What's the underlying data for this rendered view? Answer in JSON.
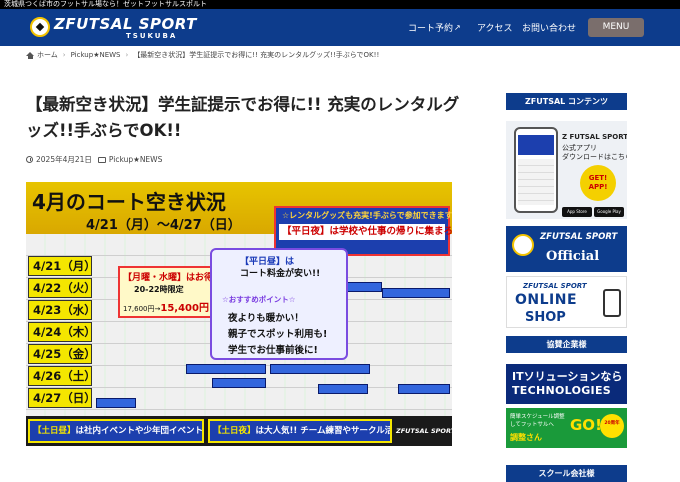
{
  "topbar": {
    "tagline": "茨城県つくば市のフットサル場なら！ゼットフットサルスポルト"
  },
  "header": {
    "logo": {
      "name": "ZFUTSAL SPORT",
      "sub": "TSUKUBA"
    },
    "nav": [
      {
        "label": "コート予約",
        "external": true
      },
      {
        "label": "アクセス",
        "external": false
      },
      {
        "label": "お問い合わせ",
        "external": false
      }
    ],
    "menu_label": "MENU"
  },
  "breadcrumb": {
    "home": "ホーム",
    "category": "Pickup★NEWS",
    "current": "【最新空き状況】学生証提示でお得に!! 充実のレンタルグッズ!!手ぶらでOK!!"
  },
  "post": {
    "title": "【最新空き状況】学生証提示でお得に!! 充実のレンタルグッズ!!手ぶらでOK!!",
    "date": "2025年4月21日",
    "category": "Pickup★NEWS"
  },
  "hero": {
    "title": "4月のコート空き状況",
    "range": "4/21（月）〜4/27（日）",
    "days": [
      "4/21（月）",
      "4/22（火）",
      "4/23（水）",
      "4/24（木）",
      "4/25（金）",
      "4/26（土）",
      "4/27（日）"
    ],
    "badge_line1": "☆レンタルグッズも充実!手ぶらで参加できます☆",
    "badge_line2": "【平日夜】は学校や仕事の帰りに集まろう!!",
    "promo1_a": "【月曜・水曜】はお得!!",
    "promo1_b": "20-22時限定",
    "promo1_c": "17,600円→",
    "promo1_price": "15,400円",
    "promo2_h": "【平日昼】は",
    "promo2_h2": "コート料金が安い!!",
    "promo2_p": "☆おすすめポイント☆",
    "promo2_q": [
      "夜よりも暖かい！",
      "親子でスポット利用も!",
      "学生でお仕事前後に!"
    ],
    "bottom_left_k": "【土日昼】",
    "bottom_left": "は社内イベントや少年団イベントに!!",
    "bottom_mid_k": "【土日夜】",
    "bottom_mid": "は大人気!! チーム練習やサークル活動にピッタリ!!",
    "bottom_logo": "ZFUTSAL SPORT"
  },
  "sidebar": {
    "contents_head": "ZFUTSAL コンテンツ",
    "app": {
      "t1": "Z FUTSAL SPORT",
      "t2": "公式アプリ",
      "t3": "ダウンロードはこちら",
      "get": "GET! APP!",
      "store1": "App Store",
      "store2": "Google Play"
    },
    "official": {
      "l1": "ZFUTSAL SPORT",
      "l2": "Official"
    },
    "shop": {
      "l1": "ZFUTSAL SPORT",
      "l2": "ONLINE",
      "l3": "SHOP"
    },
    "sponsor_head": "協賛企業様",
    "it": {
      "l1": "ITソリューションなら",
      "l2": "TECHNOLOGIES"
    },
    "green": {
      "l1": "簡単スケジュール調整",
      "l2": "してフットサルへ",
      "l3": "調整さん",
      "go": "GO!",
      "seal": "20周年"
    },
    "school_head": "スクール会社様"
  },
  "colors": {
    "brand": "#0d3c8c",
    "menu": "#7a6e6c",
    "accent_yellow": "#f4e600"
  }
}
